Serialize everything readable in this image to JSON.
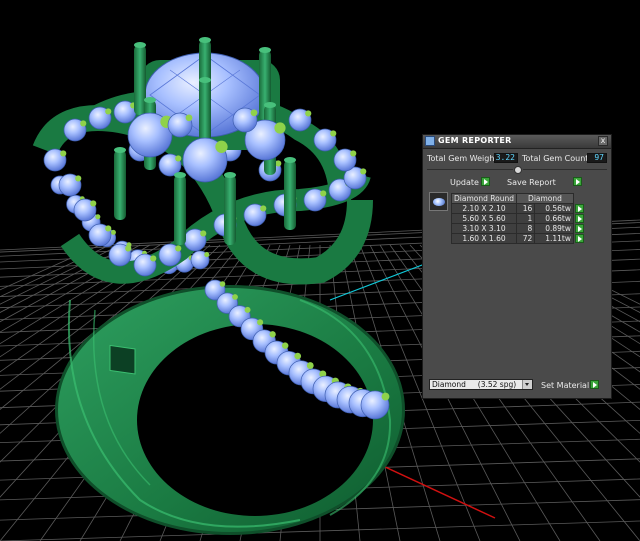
{
  "panel": {
    "title": "GEM REPORTER",
    "close_label": "x",
    "total_weight_label": "Total Gem Weight",
    "total_weight_value": "3.22",
    "total_count_label": "Total Gem Count",
    "total_count_value": "97",
    "update_label": "Update",
    "save_report_label": "Save Report",
    "table": {
      "headers": [
        "Diamond Round",
        "Diamond"
      ],
      "rows": [
        {
          "size": "2.10 X 2.10",
          "count": "16",
          "weight": "0.56tw"
        },
        {
          "size": "5.60 X 5.60",
          "count": "1",
          "weight": "0.66tw"
        },
        {
          "size": "3.10 X 3.10",
          "count": "8",
          "weight": "0.89tw"
        },
        {
          "size": "1.60 X 1.60",
          "count": "72",
          "weight": "1.11tw"
        }
      ]
    },
    "material_value": "Diamond     (3.52 spg)",
    "set_material_label": "Set Material"
  },
  "colors": {
    "viewport_bg": "#000000",
    "metal_green": "#1f8a4c",
    "gem_blue": "#9ab4ff",
    "grid": "#5a5a5a",
    "axis_red": "#d01010",
    "axis_cyan": "#10c8d8",
    "value_text": "#5fd7ff",
    "button_green": "#3aa63a"
  }
}
